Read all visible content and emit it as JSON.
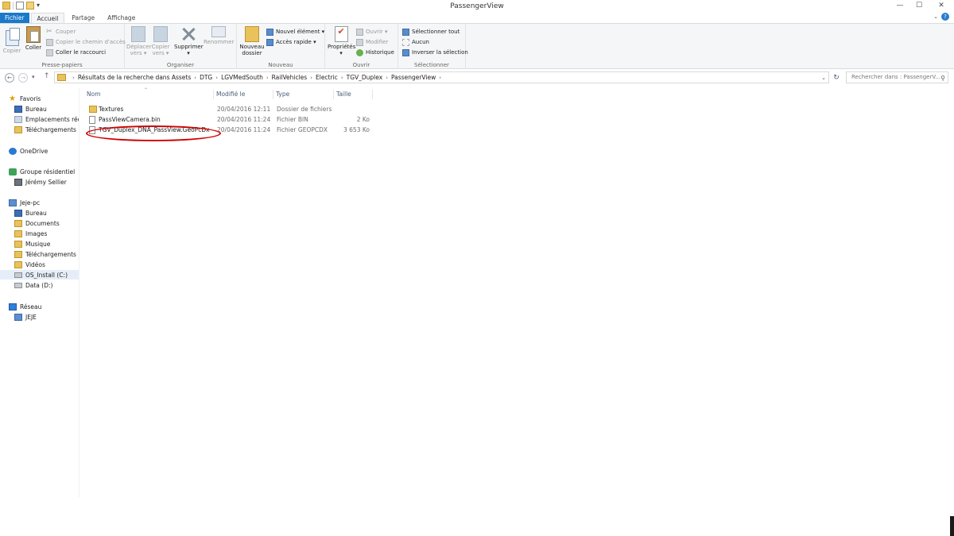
{
  "window": {
    "title": "PassengerView"
  },
  "window_buttons": [
    "—",
    "☐",
    "✕"
  ],
  "tabs": [
    {
      "label": "Fichier"
    },
    {
      "label": "Accueil"
    },
    {
      "label": "Partage"
    },
    {
      "label": "Affichage"
    }
  ],
  "ribbon": {
    "presse_papiers": {
      "label": "Presse-papiers",
      "copier": "Copier",
      "coller": "Coller",
      "couper": "Couper",
      "copier_chemin": "Copier le chemin d'accès",
      "coller_raccourci": "Coller le raccourci"
    },
    "organiser": {
      "label": "Organiser",
      "deplacer_1": "Déplacer",
      "deplacer_2": "vers ▾",
      "copier_1": "Copier",
      "copier_2": "vers ▾",
      "supprimer": "Supprimer",
      "supprimer_arrow": "▾",
      "renommer": "Renommer"
    },
    "nouveau": {
      "label": "Nouveau",
      "nouveau_dossier_1": "Nouveau",
      "nouveau_dossier_2": "dossier",
      "nouvel_element": "Nouvel élément ▾",
      "acces_rapide": "Accès rapide ▾"
    },
    "ouvrir": {
      "label": "Ouvrir",
      "proprietes": "Propriétés",
      "proprietes_arrow": "▾",
      "ouvrir": "Ouvrir ▾",
      "modifier": "Modifier",
      "historique": "Historique"
    },
    "selectionner": {
      "label": "Sélectionner",
      "tout": "Sélectionner tout",
      "aucun": "Aucun",
      "inverser": "Inverser la sélection"
    }
  },
  "address": {
    "crumbs": [
      "Résultats de la recherche dans Assets",
      "DTG",
      "LGVMedSouth",
      "RailVehicles",
      "Electric",
      "TGV_Duplex",
      "PassengerView"
    ],
    "search_placeholder": "Rechercher dans : PassengerV..."
  },
  "navpane": {
    "favoris": "Favoris",
    "bureau": "Bureau",
    "emplacements": "Emplacements récents",
    "telechargements": "Téléchargements",
    "onedrive": "OneDrive",
    "groupe": "Groupe résidentiel",
    "user": "Jérémy Sellier",
    "pc": "Jeje-pc",
    "pc_bureau": "Bureau",
    "pc_documents": "Documents",
    "pc_images": "Images",
    "pc_musique": "Musique",
    "pc_telechargements": "Téléchargements",
    "pc_videos": "Vidéos",
    "os": "OS_Install (C:)",
    "data": "Data (D:)",
    "reseau": "Réseau",
    "jeje": "JEJE"
  },
  "columns": {
    "nom": "Nom",
    "modifie": "Modifié le",
    "type": "Type",
    "taille": "Taille"
  },
  "files": [
    {
      "name": "Textures",
      "modified": "20/04/2016 12:11",
      "type": "Dossier de fichiers",
      "size": "",
      "icon": "folder-icon"
    },
    {
      "name": "PassViewCamera.bin",
      "modified": "20/04/2016 11:24",
      "type": "Fichier BIN",
      "size": "2 Ko",
      "icon": "file-icon"
    },
    {
      "name": "TGV_Duplex_DNA_PassView.GeoPcDx",
      "modified": "20/04/2016 11:24",
      "type": "Fichier GEOPCDX",
      "size": "3 653 Ko",
      "icon": "file-icon"
    }
  ],
  "colors": {
    "accent": "#1979ca",
    "annotation": "#d00000",
    "folder": "#e8c25a"
  }
}
